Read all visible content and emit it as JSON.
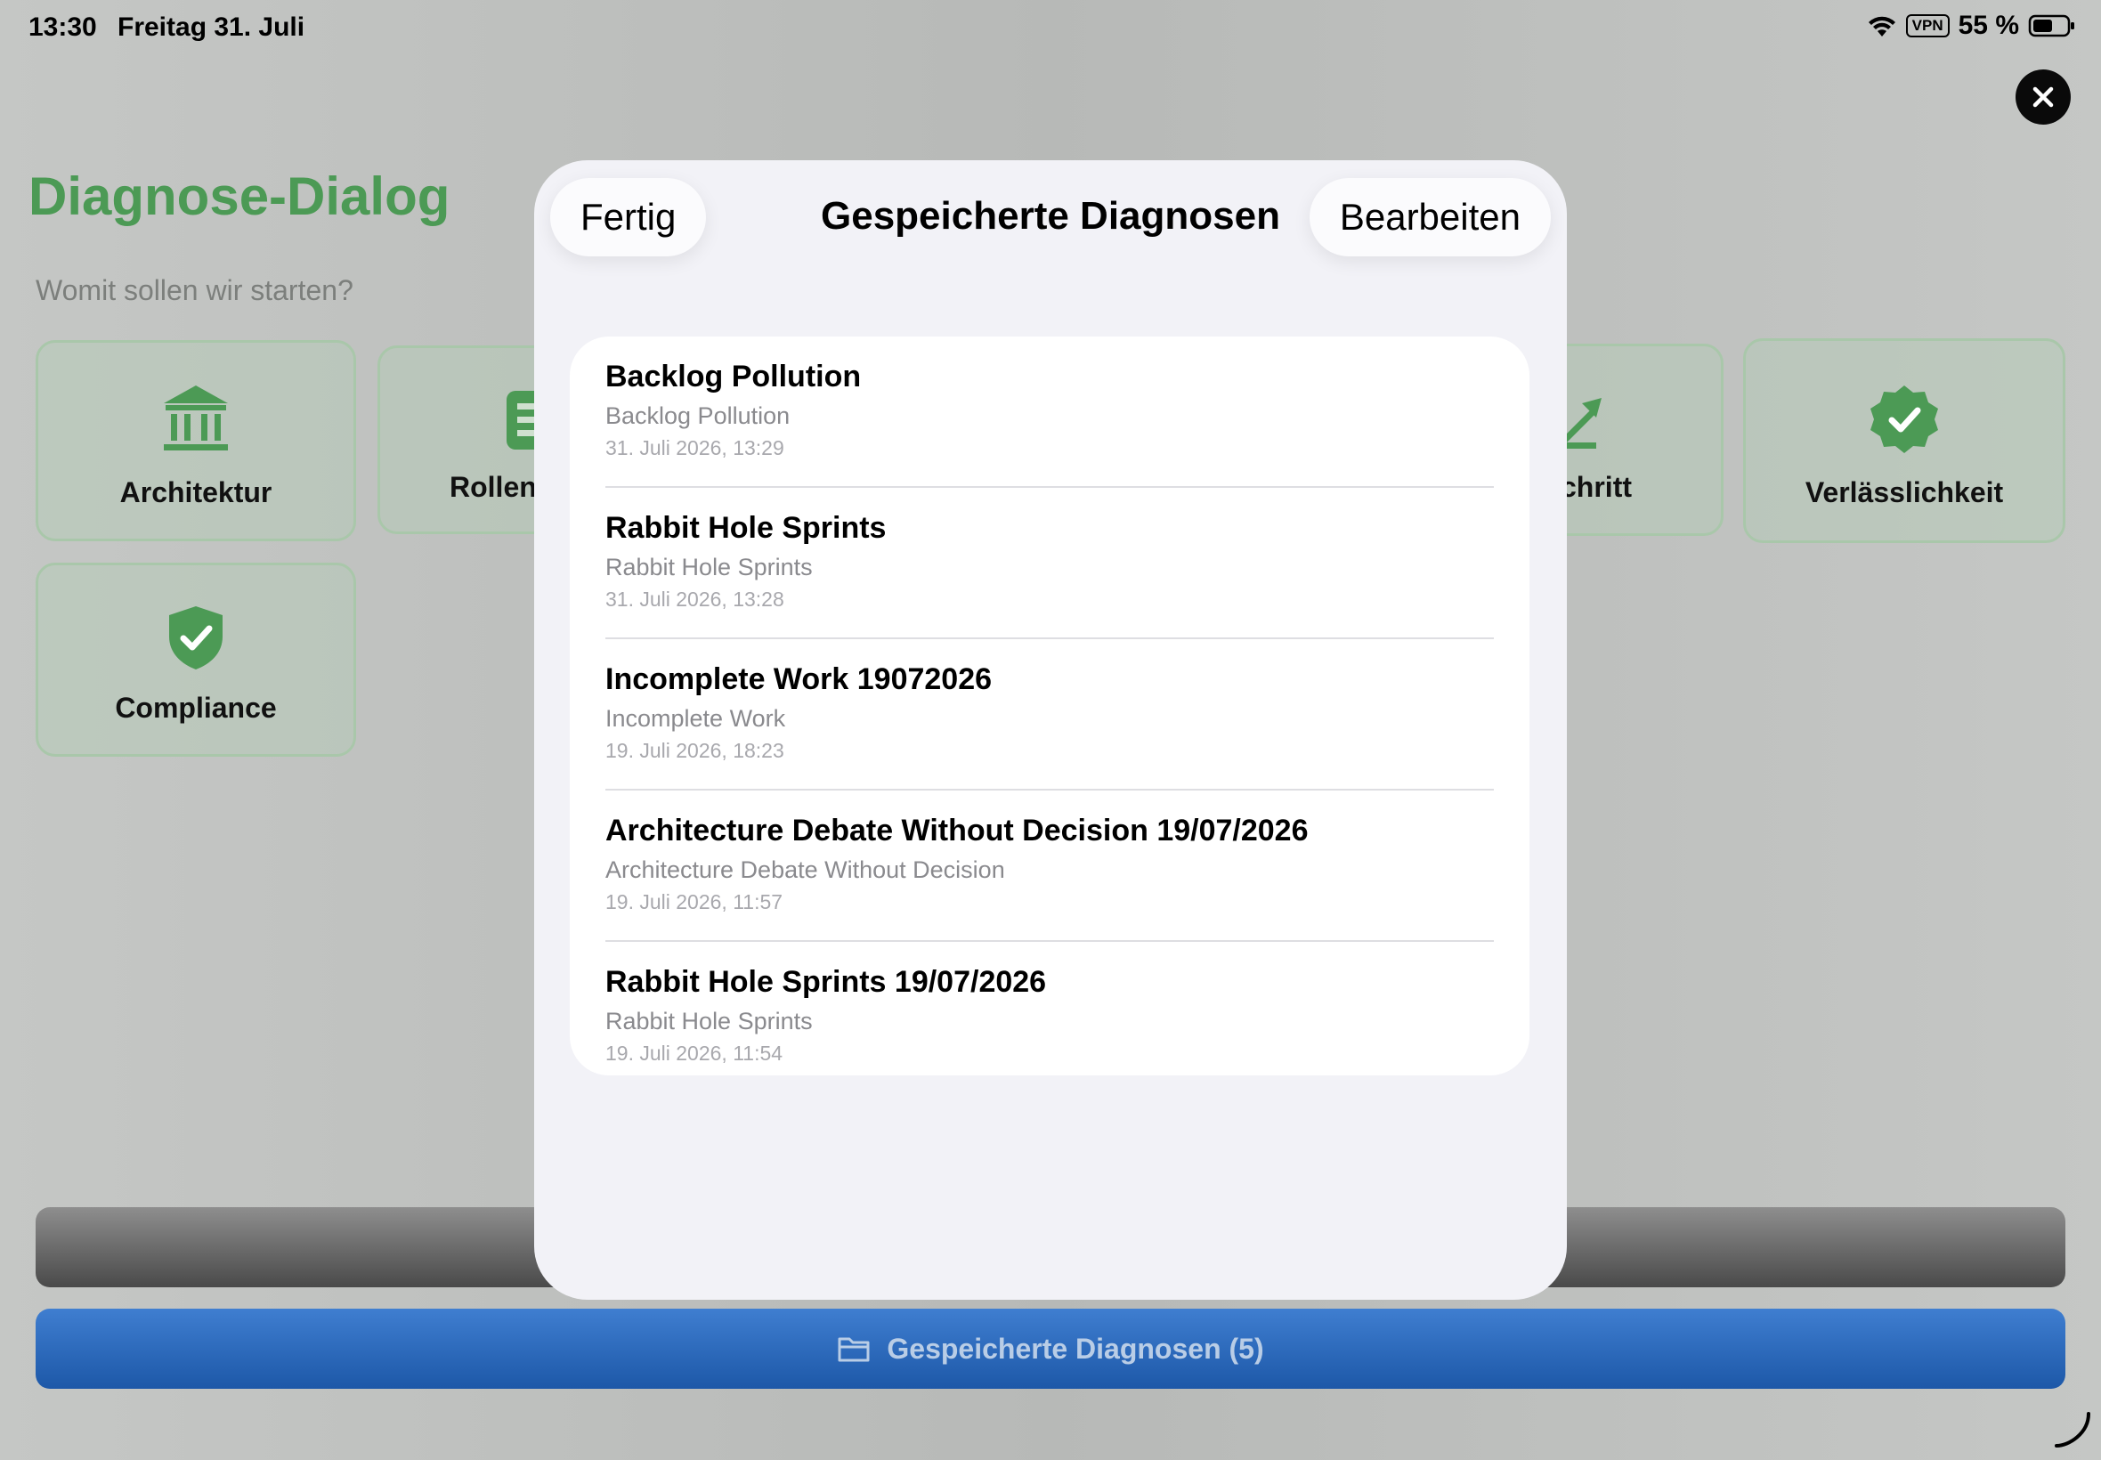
{
  "status_bar": {
    "time": "13:30",
    "date": "Freitag 31. Juli",
    "vpn": "VPN",
    "battery": "55 %"
  },
  "page": {
    "title": "Diagnose-Dialog",
    "subtitle": "Womit sollen wir starten?",
    "accent_color": "#4c9a55",
    "tiles": [
      {
        "label": "Architektur",
        "icon": "bank-icon"
      },
      {
        "label": "Rollen",
        "icon": "list-icon"
      },
      {
        "label": "chritt",
        "icon": "chart-up-icon"
      },
      {
        "label": "Verlässlichkeit",
        "icon": "checkmark-seal-icon"
      },
      {
        "label": "Compliance",
        "icon": "shield-check-icon"
      }
    ],
    "saved_button_label": "Gespeicherte Diagnosen (5)",
    "saved_button_color": "#2a67b8"
  },
  "sheet": {
    "done_label": "Fertig",
    "title": "Gespeicherte Diagnosen",
    "edit_label": "Bearbeiten",
    "items": [
      {
        "title": "Backlog Pollution",
        "subtitle": "Backlog Pollution",
        "date": "31. Juli 2026, 13:29"
      },
      {
        "title": "Rabbit Hole Sprints",
        "subtitle": "Rabbit Hole Sprints",
        "date": "31. Juli 2026, 13:28"
      },
      {
        "title": "Incomplete Work 19072026",
        "subtitle": "Incomplete Work",
        "date": "19. Juli 2026, 18:23"
      },
      {
        "title": "Architecture Debate Without Decision 19/07/2026",
        "subtitle": "Architecture Debate Without Decision",
        "date": "19. Juli 2026, 11:57"
      },
      {
        "title": "Rabbit Hole Sprints 19/07/2026",
        "subtitle": "Rabbit Hole Sprints",
        "date": "19. Juli 2026, 11:54"
      }
    ]
  }
}
